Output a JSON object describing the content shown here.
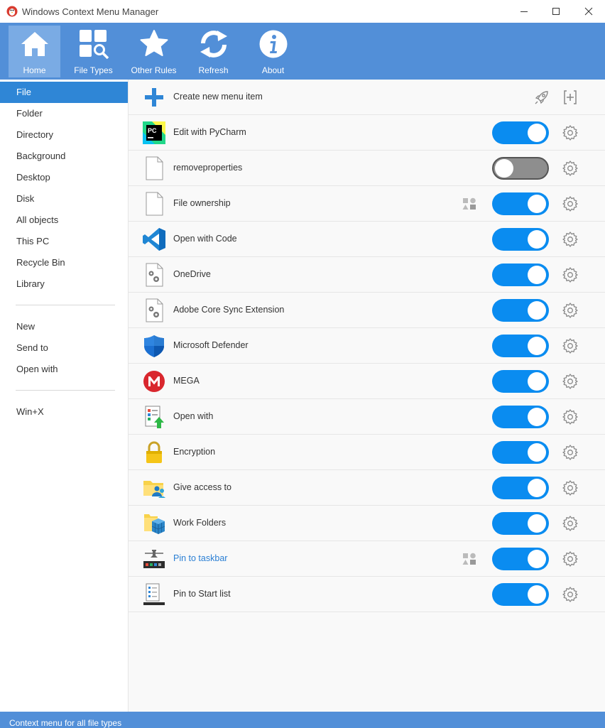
{
  "window": {
    "title": "Windows Context Menu Manager"
  },
  "toolbar": {
    "buttons": [
      {
        "label": "Home",
        "icon": "home-icon",
        "active": true
      },
      {
        "label": "File Types",
        "icon": "file-types-icon"
      },
      {
        "label": "Other Rules",
        "icon": "star-icon"
      },
      {
        "label": "Refresh",
        "icon": "refresh-icon"
      },
      {
        "label": "About",
        "icon": "info-icon"
      }
    ]
  },
  "sidebar": {
    "items": [
      {
        "label": "File",
        "selected": true
      },
      {
        "label": "Folder"
      },
      {
        "label": "Directory"
      },
      {
        "label": "Background"
      },
      {
        "label": "Desktop"
      },
      {
        "label": "Disk"
      },
      {
        "label": "All objects"
      },
      {
        "label": "This PC"
      },
      {
        "label": "Recycle Bin"
      },
      {
        "label": "Library"
      },
      {
        "label": "New"
      },
      {
        "label": "Send to"
      },
      {
        "label": "Open with"
      },
      {
        "label": "Win+X"
      }
    ]
  },
  "menu_items": [
    {
      "label": "Create new menu item",
      "icon": "plus-icon",
      "kind": "create"
    },
    {
      "label": "Edit with PyCharm",
      "icon": "pycharm-icon",
      "enabled": true
    },
    {
      "label": "removeproperties",
      "icon": "blank-file-icon",
      "enabled": false
    },
    {
      "label": "File ownership",
      "icon": "blank-file-icon",
      "enabled": true,
      "shapes": true
    },
    {
      "label": "Open with Code",
      "icon": "vscode-icon",
      "enabled": true
    },
    {
      "label": "OneDrive",
      "icon": "settings-file-icon",
      "enabled": true
    },
    {
      "label": "Adobe Core Sync Extension",
      "icon": "settings-file-icon",
      "enabled": true
    },
    {
      "label": "Microsoft Defender",
      "icon": "defender-shield-icon",
      "enabled": true
    },
    {
      "label": "MEGA",
      "icon": "mega-icon",
      "enabled": true
    },
    {
      "label": "Open with",
      "icon": "open-with-icon",
      "enabled": true
    },
    {
      "label": "Encryption",
      "icon": "padlock-icon",
      "enabled": true
    },
    {
      "label": "Give access to",
      "icon": "share-folder-icon",
      "enabled": true
    },
    {
      "label": "Work Folders",
      "icon": "work-folders-icon",
      "enabled": true
    },
    {
      "label": "Pin to taskbar",
      "icon": "taskbar-pin-icon",
      "enabled": true,
      "shapes": true,
      "link": true
    },
    {
      "label": "Pin to Start list",
      "icon": "start-pin-icon",
      "enabled": true
    }
  ],
  "status": {
    "text": "Context menu for all file types"
  },
  "colors": {
    "accent": "#528fd8",
    "selected": "#2f86d6",
    "toggle_on": "#0a8cf0",
    "toggle_off": "#8e8e8e"
  }
}
